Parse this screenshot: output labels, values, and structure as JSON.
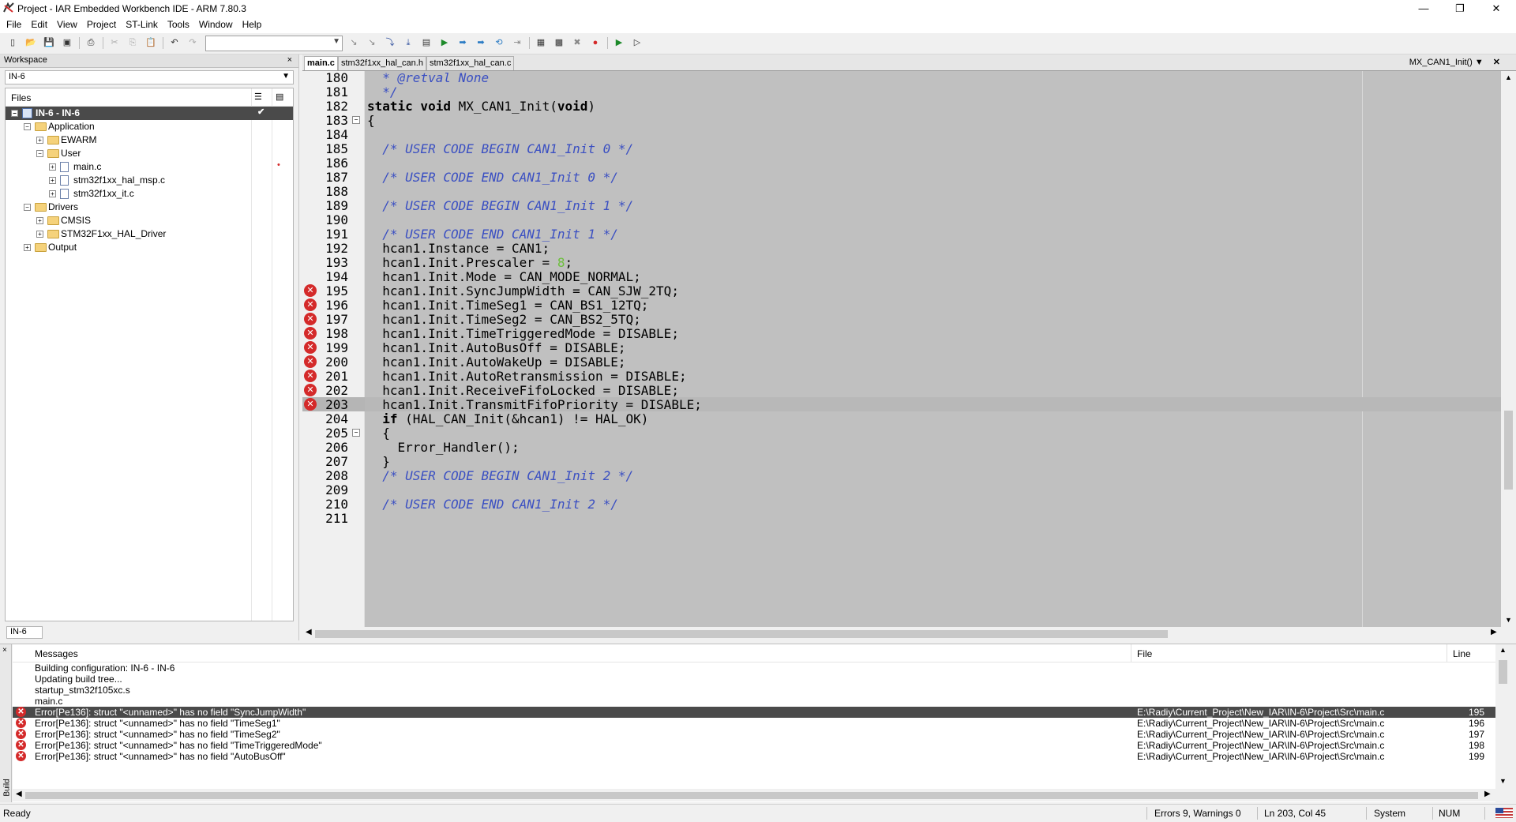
{
  "window": {
    "title": "Project - IAR Embedded Workbench IDE - ARM 7.80.3",
    "minimize": "—",
    "restore": "❐",
    "close": "✕"
  },
  "menu": [
    "File",
    "Edit",
    "View",
    "Project",
    "ST-Link",
    "Tools",
    "Window",
    "Help"
  ],
  "toolbar": {
    "combo_value": "",
    "icons": [
      "new-file-icon",
      "open-icon",
      "save-icon",
      "save-all-icon",
      "print-icon",
      "cut-icon",
      "copy-icon",
      "paste-icon",
      "undo-icon",
      "redo-icon",
      "find-icon",
      "find-next-icon",
      "find-prev-icon",
      "find-in-files-icon",
      "go-to-icon",
      "bookmark-icon",
      "next-bookmark-icon",
      "prev-bookmark-icon",
      "nav-back-icon",
      "nav-forward-icon",
      "compile-icon",
      "make-icon",
      "stop-build-icon",
      "toggle-breakpoint-icon",
      "download-debug-icon",
      "debug-without-download-icon"
    ]
  },
  "workspace": {
    "title": "Workspace",
    "close": "×",
    "config": "IN-6",
    "files_header": "Files",
    "tab": "IN-6",
    "tree": [
      {
        "label": "IN-6 - IN-6",
        "level": 0,
        "kind": "project",
        "expander": "−",
        "selected": true,
        "checked": true
      },
      {
        "label": "Application",
        "level": 1,
        "kind": "folder",
        "expander": "−"
      },
      {
        "label": "EWARM",
        "level": 2,
        "kind": "folder",
        "expander": "+"
      },
      {
        "label": "User",
        "level": 2,
        "kind": "folder",
        "expander": "−"
      },
      {
        "label": "main.c",
        "level": 3,
        "kind": "file",
        "expander": "+",
        "modified": true
      },
      {
        "label": "stm32f1xx_hal_msp.c",
        "level": 3,
        "kind": "file",
        "expander": "+"
      },
      {
        "label": "stm32f1xx_it.c",
        "level": 3,
        "kind": "file",
        "expander": "+"
      },
      {
        "label": "Drivers",
        "level": 1,
        "kind": "folder",
        "expander": "−"
      },
      {
        "label": "CMSIS",
        "level": 2,
        "kind": "folder",
        "expander": "+"
      },
      {
        "label": "STM32F1xx_HAL_Driver",
        "level": 2,
        "kind": "folder",
        "expander": "+"
      },
      {
        "label": "Output",
        "level": 1,
        "kind": "folder",
        "expander": "+"
      }
    ]
  },
  "editor": {
    "tabs": [
      "main.c",
      "stm32f1xx_hal_can.h",
      "stm32f1xx_hal_can.c"
    ],
    "active_tab": 0,
    "function": "MX_CAN1_Init()",
    "lines": [
      {
        "n": "180",
        "text": "  * @retval None",
        "style": "cmt"
      },
      {
        "n": "181",
        "text": "  */",
        "style": "cmt"
      },
      {
        "n": "182",
        "text": "static void MX_CAN1_Init(void)",
        "style": "sig"
      },
      {
        "n": "183",
        "text": "{",
        "fold": "−"
      },
      {
        "n": "184",
        "text": ""
      },
      {
        "n": "185",
        "text": "  /* USER CODE BEGIN CAN1_Init 0 */",
        "style": "cmt"
      },
      {
        "n": "186",
        "text": ""
      },
      {
        "n": "187",
        "text": "  /* USER CODE END CAN1_Init 0 */",
        "style": "cmt"
      },
      {
        "n": "188",
        "text": ""
      },
      {
        "n": "189",
        "text": "  /* USER CODE BEGIN CAN1_Init 1 */",
        "style": "cmt"
      },
      {
        "n": "190",
        "text": ""
      },
      {
        "n": "191",
        "text": "  /* USER CODE END CAN1_Init 1 */",
        "style": "cmt"
      },
      {
        "n": "192",
        "text": "  hcan1.Instance = CAN1;"
      },
      {
        "n": "193",
        "text": "  hcan1.Init.Prescaler = 8;",
        "style": "num"
      },
      {
        "n": "194",
        "text": "  hcan1.Init.Mode = CAN_MODE_NORMAL;"
      },
      {
        "n": "195",
        "text": "  hcan1.Init.SyncJumpWidth = CAN_SJW_2TQ;",
        "error": true
      },
      {
        "n": "196",
        "text": "  hcan1.Init.TimeSeg1 = CAN_BS1_12TQ;",
        "error": true
      },
      {
        "n": "197",
        "text": "  hcan1.Init.TimeSeg2 = CAN_BS2_5TQ;",
        "error": true
      },
      {
        "n": "198",
        "text": "  hcan1.Init.TimeTriggeredMode = DISABLE;",
        "error": true
      },
      {
        "n": "199",
        "text": "  hcan1.Init.AutoBusOff = DISABLE;",
        "error": true
      },
      {
        "n": "200",
        "text": "  hcan1.Init.AutoWakeUp = DISABLE;",
        "error": true
      },
      {
        "n": "201",
        "text": "  hcan1.Init.AutoRetransmission = DISABLE;",
        "error": true
      },
      {
        "n": "202",
        "text": "  hcan1.Init.ReceiveFifoLocked = DISABLE;",
        "error": true
      },
      {
        "n": "203",
        "text": "  hcan1.Init.TransmitFifoPriority = DISABLE;",
        "error": true,
        "current": true
      },
      {
        "n": "204",
        "text": "  if (HAL_CAN_Init(&hcan1) != HAL_OK)",
        "style": "if"
      },
      {
        "n": "205",
        "text": "  {",
        "fold": "−"
      },
      {
        "n": "206",
        "text": "    Error_Handler();"
      },
      {
        "n": "207",
        "text": "  }"
      },
      {
        "n": "208",
        "text": "  /* USER CODE BEGIN CAN1_Init 2 */",
        "style": "cmt"
      },
      {
        "n": "209",
        "text": ""
      },
      {
        "n": "210",
        "text": "  /* USER CODE END CAN1_Init 2 */",
        "style": "cmt"
      },
      {
        "n": "211",
        "text": ""
      }
    ]
  },
  "build": {
    "side_label": "Build",
    "close": "×",
    "headers": {
      "messages": "Messages",
      "file": "File",
      "line": "Line"
    },
    "rows": [
      {
        "msg": "Building configuration: IN-6 - IN-6",
        "file": "",
        "line": ""
      },
      {
        "msg": "Updating build tree...",
        "file": "",
        "line": ""
      },
      {
        "msg": "startup_stm32f105xc.s",
        "file": "",
        "line": ""
      },
      {
        "msg": "main.c",
        "file": "",
        "line": ""
      },
      {
        "msg": "Error[Pe136]: struct \"<unnamed>\" has no field \"SyncJumpWidth\"",
        "file": "E:\\Radiy\\Current_Project\\New_IAR\\IN-6\\Project\\Src\\main.c",
        "line": "195",
        "error": true,
        "selected": true
      },
      {
        "msg": "Error[Pe136]: struct \"<unnamed>\" has no field \"TimeSeg1\"",
        "file": "E:\\Radiy\\Current_Project\\New_IAR\\IN-6\\Project\\Src\\main.c",
        "line": "196",
        "error": true
      },
      {
        "msg": "Error[Pe136]: struct \"<unnamed>\" has no field \"TimeSeg2\"",
        "file": "E:\\Radiy\\Current_Project\\New_IAR\\IN-6\\Project\\Src\\main.c",
        "line": "197",
        "error": true
      },
      {
        "msg": "Error[Pe136]: struct \"<unnamed>\" has no field \"TimeTriggeredMode\"",
        "file": "E:\\Radiy\\Current_Project\\New_IAR\\IN-6\\Project\\Src\\main.c",
        "line": "198",
        "error": true
      },
      {
        "msg": "Error[Pe136]: struct \"<unnamed>\" has no field \"AutoBusOff\"",
        "file": "E:\\Radiy\\Current_Project\\New_IAR\\IN-6\\Project\\Src\\main.c",
        "line": "199",
        "error": true
      }
    ]
  },
  "status": {
    "ready": "Ready",
    "errors": "Errors 9, Warnings 0",
    "position": "Ln 203, Col 45",
    "encoding": "System",
    "num": "NUM"
  }
}
